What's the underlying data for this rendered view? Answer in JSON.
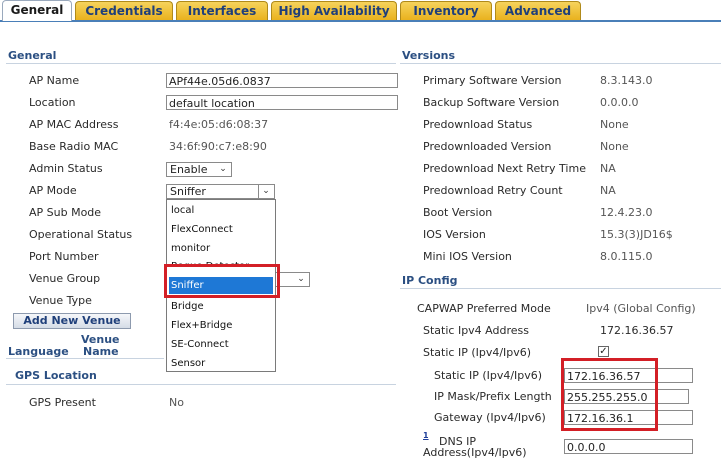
{
  "tabs": [
    "General",
    "Credentials",
    "Interfaces",
    "High Availability",
    "Inventory",
    "Advanced"
  ],
  "general": {
    "heading": "General",
    "fields": [
      {
        "label": "AP Name",
        "value": "APf44e.05d6.0837"
      },
      {
        "label": "Location",
        "value": "default location"
      },
      {
        "label": "AP MAC Address",
        "value": "f4:4e:05:d6:08:37"
      },
      {
        "label": "Base Radio MAC",
        "value": "34:6f:90:c7:e8:90"
      },
      {
        "label": "Admin Status",
        "value": "Enable"
      },
      {
        "label": "AP Mode",
        "value": "Sniffer"
      },
      {
        "label": "AP Sub Mode",
        "value": ""
      },
      {
        "label": "Operational Status",
        "value": ""
      },
      {
        "label": "Port Number",
        "value": ""
      },
      {
        "label": "Venue Group",
        "value": ""
      },
      {
        "label": "Venue Type",
        "value": ""
      }
    ],
    "add_venue_button": "Add New Venue",
    "venue_table": {
      "col1": "Language",
      "col2_line1": "Venue",
      "col2_line2": "Name"
    },
    "gps_heading": "GPS Location",
    "gps_present_label": "GPS Present",
    "gps_present_value": "No"
  },
  "ap_mode_options": [
    "local",
    "FlexConnect",
    "monitor",
    "Rogue Detector",
    "Sniffer",
    "Bridge",
    "Flex+Bridge",
    "SE-Connect",
    "Sensor"
  ],
  "ap_mode_selected": "Sniffer",
  "versions": {
    "heading": "Versions",
    "rows": [
      {
        "label": "Primary Software Version",
        "value": "8.3.143.0"
      },
      {
        "label": "Backup Software Version",
        "value": "0.0.0.0"
      },
      {
        "label": "Predownload Status",
        "value": "None"
      },
      {
        "label": "Predownloaded Version",
        "value": "None"
      },
      {
        "label": "Predownload Next Retry Time",
        "value": "NA"
      },
      {
        "label": "Predownload Retry Count",
        "value": "NA"
      },
      {
        "label": "Boot Version",
        "value": "12.4.23.0"
      },
      {
        "label": "IOS Version",
        "value": "15.3(3)JD16$"
      },
      {
        "label": "Mini IOS Version",
        "value": "8.0.115.0"
      }
    ]
  },
  "ip_config": {
    "heading": "IP Config",
    "capwap_label": "CAPWAP Preferred Mode",
    "capwap_value": "Ipv4 (Global Config)",
    "static_ipv4_label": "Static Ipv4 Address",
    "static_ipv4_value": "172.16.36.57",
    "static_ip_label": "Static IP (Ipv4/Ipv6)",
    "static_ip_checked": "✓",
    "ip_label": "Static IP (Ipv4/Ipv6)",
    "ip_value": "172.16.36.57",
    "mask_label": "IP Mask/Prefix Length",
    "mask_value": "255.255.255.0",
    "gateway_label": "Gateway (Ipv4/Ipv6)",
    "gateway_value": "172.16.36.1",
    "dns_footnote": "1",
    "dns_label_line1": "DNS IP",
    "dns_label_line2": "Address(Ipv4/Ipv6)",
    "dns_value": "0.0.0.0"
  },
  "colors": {
    "accent": "#2b4f82",
    "highlight": "#1e78d6",
    "annotation": "#d31f26",
    "tab": "#e9b21e"
  }
}
